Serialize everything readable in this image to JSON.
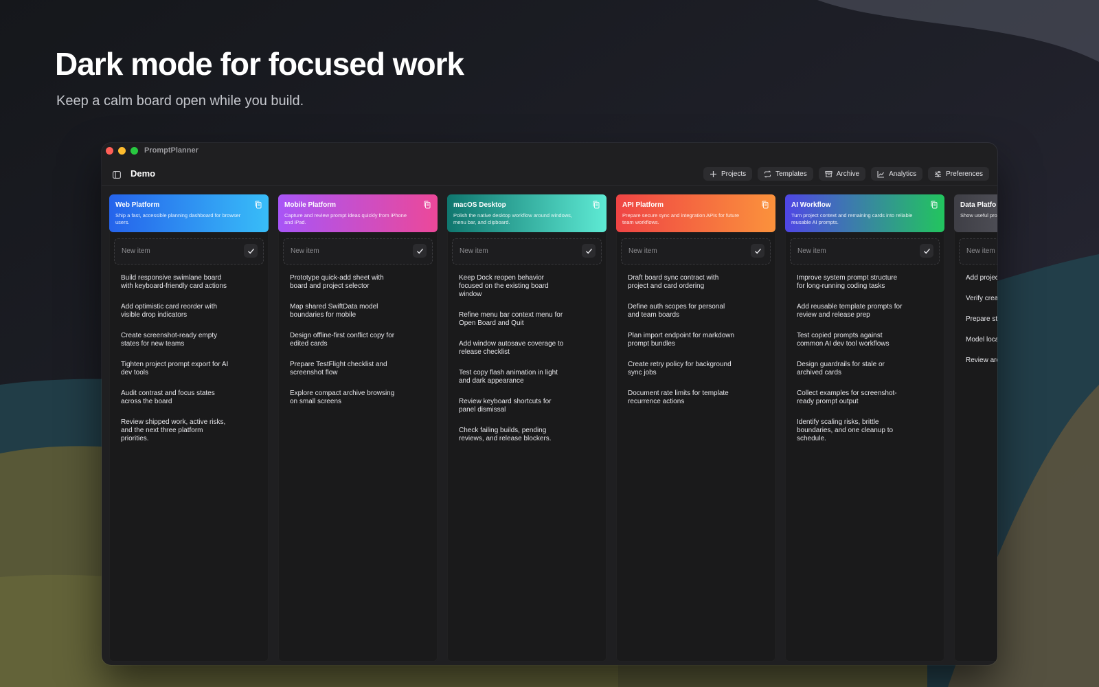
{
  "hero": {
    "title": "Dark mode for focused work",
    "subtitle": "Keep a calm board open while you build."
  },
  "window": {
    "app_name": "PromptPlanner",
    "board_title": "Demo"
  },
  "toolbar": {
    "projects": "Projects",
    "templates": "Templates",
    "archive": "Archive",
    "analytics": "Analytics",
    "preferences": "Preferences"
  },
  "new_item_placeholder": "New item",
  "colors": {
    "web_platform": [
      "#2563eb",
      "#38bdf8"
    ],
    "mobile_platform": [
      "#a855f7",
      "#ec4899"
    ],
    "macos_desktop": [
      "#0f766e",
      "#5eead4"
    ],
    "api_platform": [
      "#ef4444",
      "#fb923c"
    ],
    "ai_workflow": [
      "#4f46e5",
      "#22c55e"
    ],
    "data_platform": [
      "#3f3f46",
      "#71717a"
    ]
  },
  "columns": [
    {
      "title": "Web Platform",
      "description": "Ship a fast, accessible planning dashboard for browser users.",
      "cards": [
        "Build responsive swimlane board with keyboard-friendly card actions",
        "Add optimistic card reorder with visible drop indicators",
        "Create screenshot-ready empty states for new teams",
        "Tighten project prompt export for AI dev tools",
        "Audit contrast and focus states across the board",
        "Review shipped work, active risks, and the next three platform priorities."
      ]
    },
    {
      "title": "Mobile Platform",
      "description": "Capture and review prompt ideas quickly from iPhone and iPad.",
      "cards": [
        "Prototype quick-add sheet with board and project selector",
        "Map shared SwiftData model boundaries for mobile",
        "Design offline-first conflict copy for edited cards",
        "Prepare TestFlight checklist and screenshot flow",
        "Explore compact archive browsing on small screens"
      ]
    },
    {
      "title": "macOS Desktop",
      "description": "Polish the native desktop workflow around windows, menu bar, and clipboard.",
      "cards": [
        "Keep Dock reopen behavior focused on the existing board window",
        "Refine menu bar context menu for Open Board and Quit",
        "Add window autosave coverage to release checklist",
        "Test copy flash animation in light and dark appearance",
        "Review keyboard shortcuts for panel dismissal",
        "Check failing builds, pending reviews, and release blockers."
      ]
    },
    {
      "title": "API Platform",
      "description": "Prepare secure sync and integration APIs for future team workflows.",
      "cards": [
        "Draft board sync contract with project and card ordering",
        "Define auth scopes for personal and team boards",
        "Plan import endpoint for markdown prompt bundles",
        "Create retry policy for background sync jobs",
        "Document rate limits for template recurrence actions"
      ]
    },
    {
      "title": "AI Workflow",
      "description": "Turn project context and remaining cards into reliable reusable AI prompts.",
      "cards": [
        "Improve system prompt structure for long-running coding tasks",
        "Add reusable template prompts for review and release prep",
        "Test copied prompts against common AI dev tool workflows",
        "Design guardrails for stale or archived cards",
        "Collect examples for screenshot-ready prompt output",
        "Identify scaling risks, brittle boundaries, and one cleanup to schedule."
      ]
    },
    {
      "title": "Data Platfo",
      "description": "Show useful pro prompt content",
      "cards": [
        "Add projec for analytic",
        "Verify crea chart over",
        "Prepare st Store scree",
        "Model loca for store su",
        "Review arc bulk compl"
      ]
    }
  ]
}
